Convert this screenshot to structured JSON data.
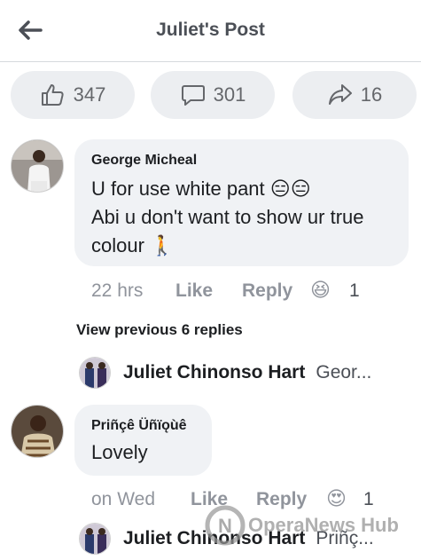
{
  "header": {
    "title": "Juliet's Post"
  },
  "stats": {
    "likes": "347",
    "comments": "301",
    "shares": "16"
  },
  "comment1": {
    "author": "George Micheal",
    "line1": "U for use white pant 😑😑",
    "line2": "Abi u don't want to show ur true",
    "line3": "colour 🚶",
    "time": "22 hrs",
    "like_label": "Like",
    "reply_label": "Reply",
    "reaction_emoji": "😆",
    "reaction_count": "1"
  },
  "view_previous": "View previous 6 replies",
  "reply1": {
    "author": "Juliet Chinonso Hart",
    "preview": "Geor..."
  },
  "comment2": {
    "author": "Priñçê Üñïǫùê",
    "text": "Lovely",
    "time": "on Wed",
    "like_label": "Like",
    "reply_label": "Reply",
    "reaction_emoji": "😍",
    "reaction_count": "1"
  },
  "reply2": {
    "author": "Juliet Chinonso Hart",
    "preview": "Priñç..."
  },
  "watermark": {
    "text": "OperaNews Hub"
  },
  "colors": {
    "pill_bg": "#eceef1",
    "bubble_bg": "#f0f2f5",
    "muted": "#90949c"
  }
}
